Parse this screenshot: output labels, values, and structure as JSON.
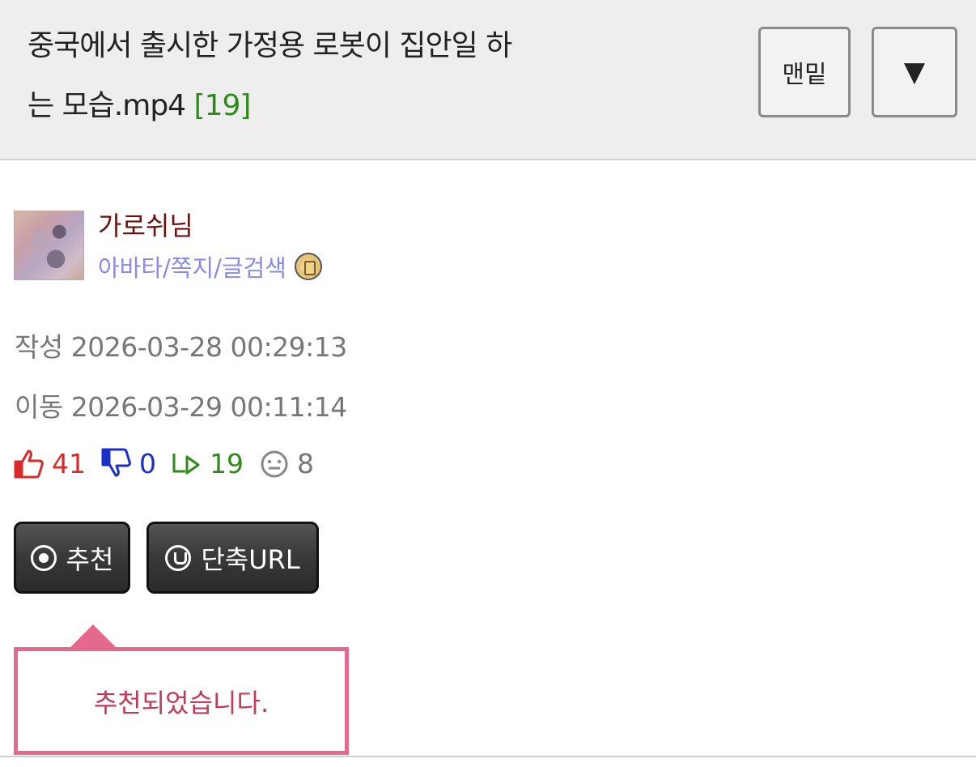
{
  "post": {
    "title_line1": "중국에서 출시한 가정용 로봇이 집안일 하",
    "title_line2": "는 모습.mp4",
    "comment_count": "[19]"
  },
  "header": {
    "bottom_button": "맨밑",
    "toggle_button": "▼"
  },
  "author": {
    "nickname": "가로쉬님",
    "links": "아바타/쪽지/글검색"
  },
  "meta": {
    "written": "작성 2026-03-28 00:29:13",
    "moved": "이동 2026-03-29 00:11:14"
  },
  "stats": {
    "upvotes": "41",
    "downvotes": "0",
    "replies": "19",
    "views": "8"
  },
  "actions": {
    "recommend_label": "추천",
    "short_url_label": "단축URL"
  },
  "tooltip": {
    "message": "추천되었습니다."
  },
  "colors": {
    "upvote": "#d92a2a",
    "downvote": "#1a2fc9",
    "reply": "#2e8b1a",
    "nickname": "#6b1210",
    "links": "#8a8ae6",
    "tooltip_border": "#e5698c"
  }
}
